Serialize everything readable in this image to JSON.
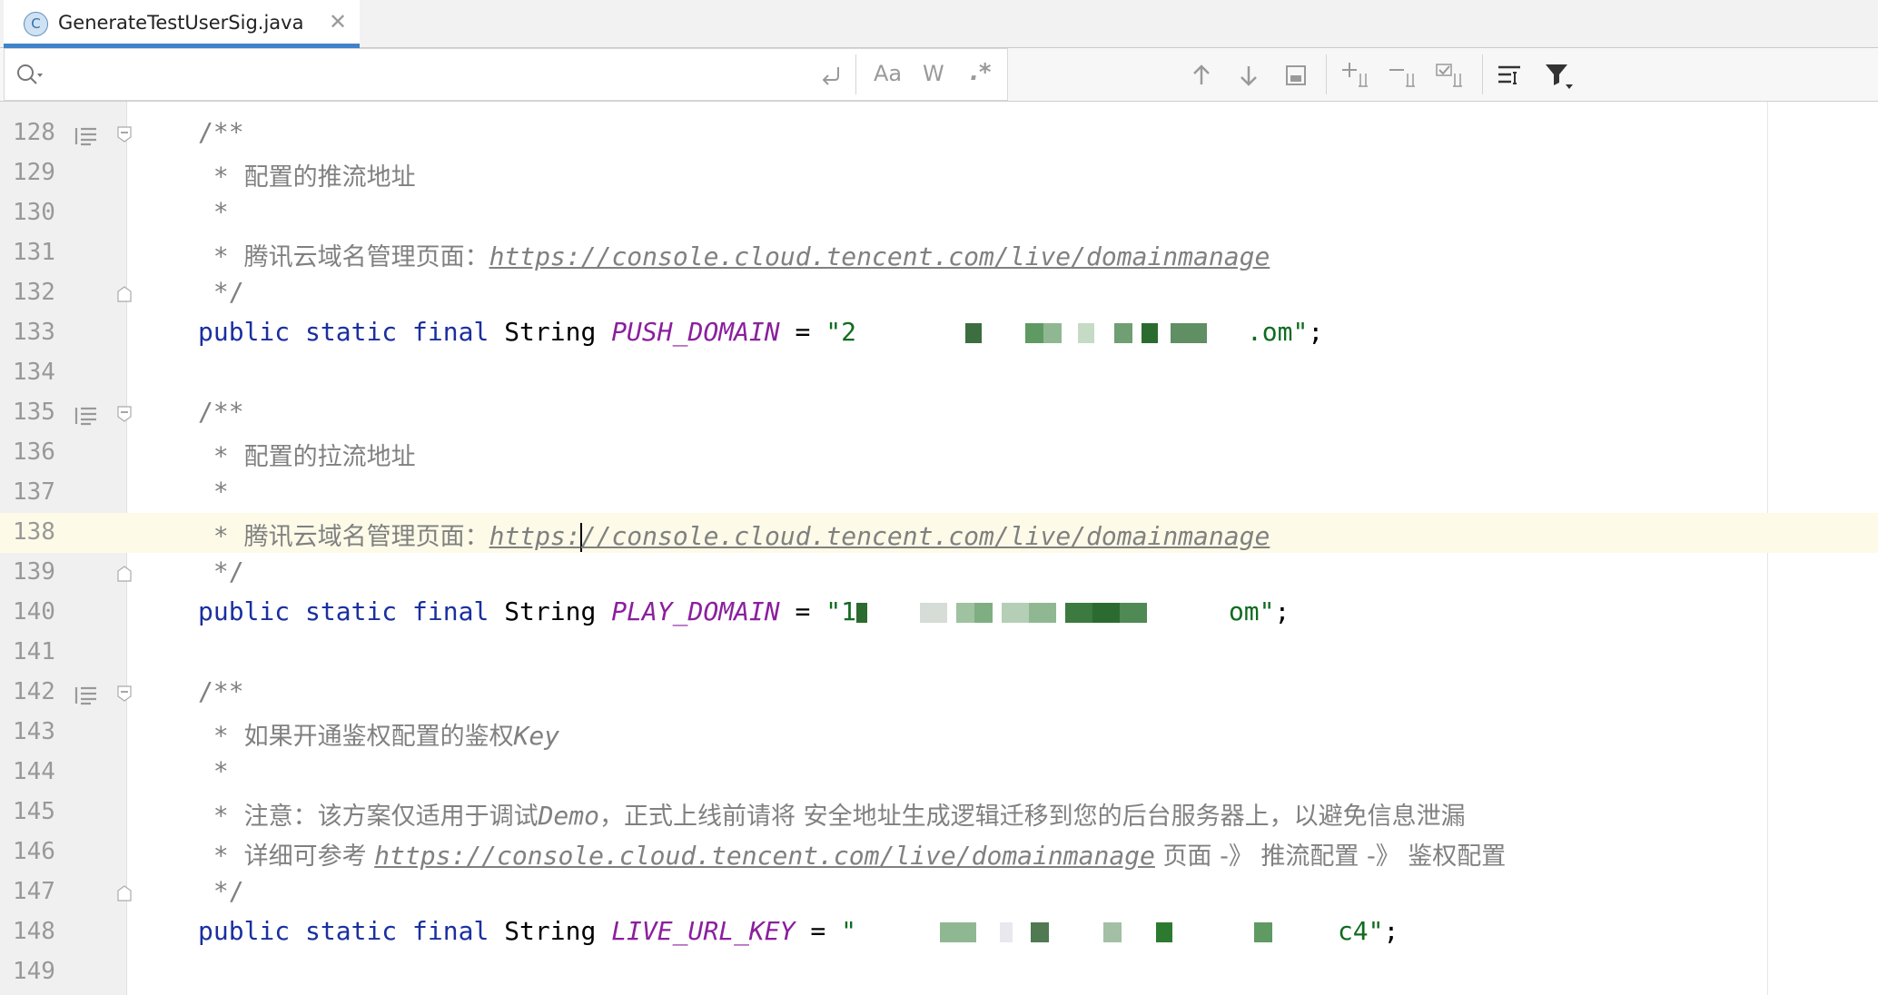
{
  "tab": {
    "title": "GenerateTestUserSig.java",
    "icon": "C",
    "close": "✕"
  },
  "search": {
    "placeholder": "",
    "match_case": "Aa",
    "words": "W",
    "regex": ".*"
  },
  "lines": {
    "l128": "128",
    "l129": "129",
    "l130": "130",
    "l131": "131",
    "l132": "132",
    "l133": "133",
    "l134": "134",
    "l135": "135",
    "l136": "136",
    "l137": "137",
    "l138": "138",
    "l139": "139",
    "l140": "140",
    "l141": "141",
    "l142": "142",
    "l143": "143",
    "l144": "144",
    "l145": "145",
    "l146": "146",
    "l147": "147",
    "l148": "148",
    "l149": "149"
  },
  "code": {
    "doc_open": "/**",
    "doc_close": "*/",
    "star": "*",
    "push_comment": "配置的推流地址",
    "domain_label": "腾讯云域名管理页面：",
    "url": "https://console.cloud.tencent.com/live/domainmanage",
    "url_part1": "https:",
    "url_part2": "//console.cloud.tencent.com/live/domainmanage",
    "kw_public": "public",
    "kw_static": "static",
    "kw_final": "final",
    "type_string": "String",
    "push_name": "PUSH_DOMAIN",
    "play_name": "PLAY_DOMAIN",
    "key_name": "LIVE_URL_KEY",
    "equals": "=",
    "push_value_start": "\"2",
    "push_value_end": ".om\"",
    "play_value_start": "\"1",
    "play_value_end": "om\"",
    "key_value_start": "\"",
    "key_value_end": "c4\"",
    "semicolon": ";",
    "pull_comment": "配置的拉流地址",
    "auth_comment": "如果开通鉴权配置的鉴权",
    "auth_key": "Key",
    "note_prefix": "注意：该方案仅适用于调试",
    "note_demo": "Demo",
    "note_suffix": "，正式上线前请将 安全地址生成逻辑迁移到您的后台服务器上，以避免信息泄漏",
    "ref_prefix": "详细可参考 ",
    "ref_suffix": " 页面 -》 推流配置 -》 鉴权配置"
  },
  "colors": {
    "accent": "#4083c9",
    "keyword": "#1a2fa0",
    "constant": "#8b1f9e",
    "string": "#0f6b1e",
    "comment": "#808080"
  }
}
